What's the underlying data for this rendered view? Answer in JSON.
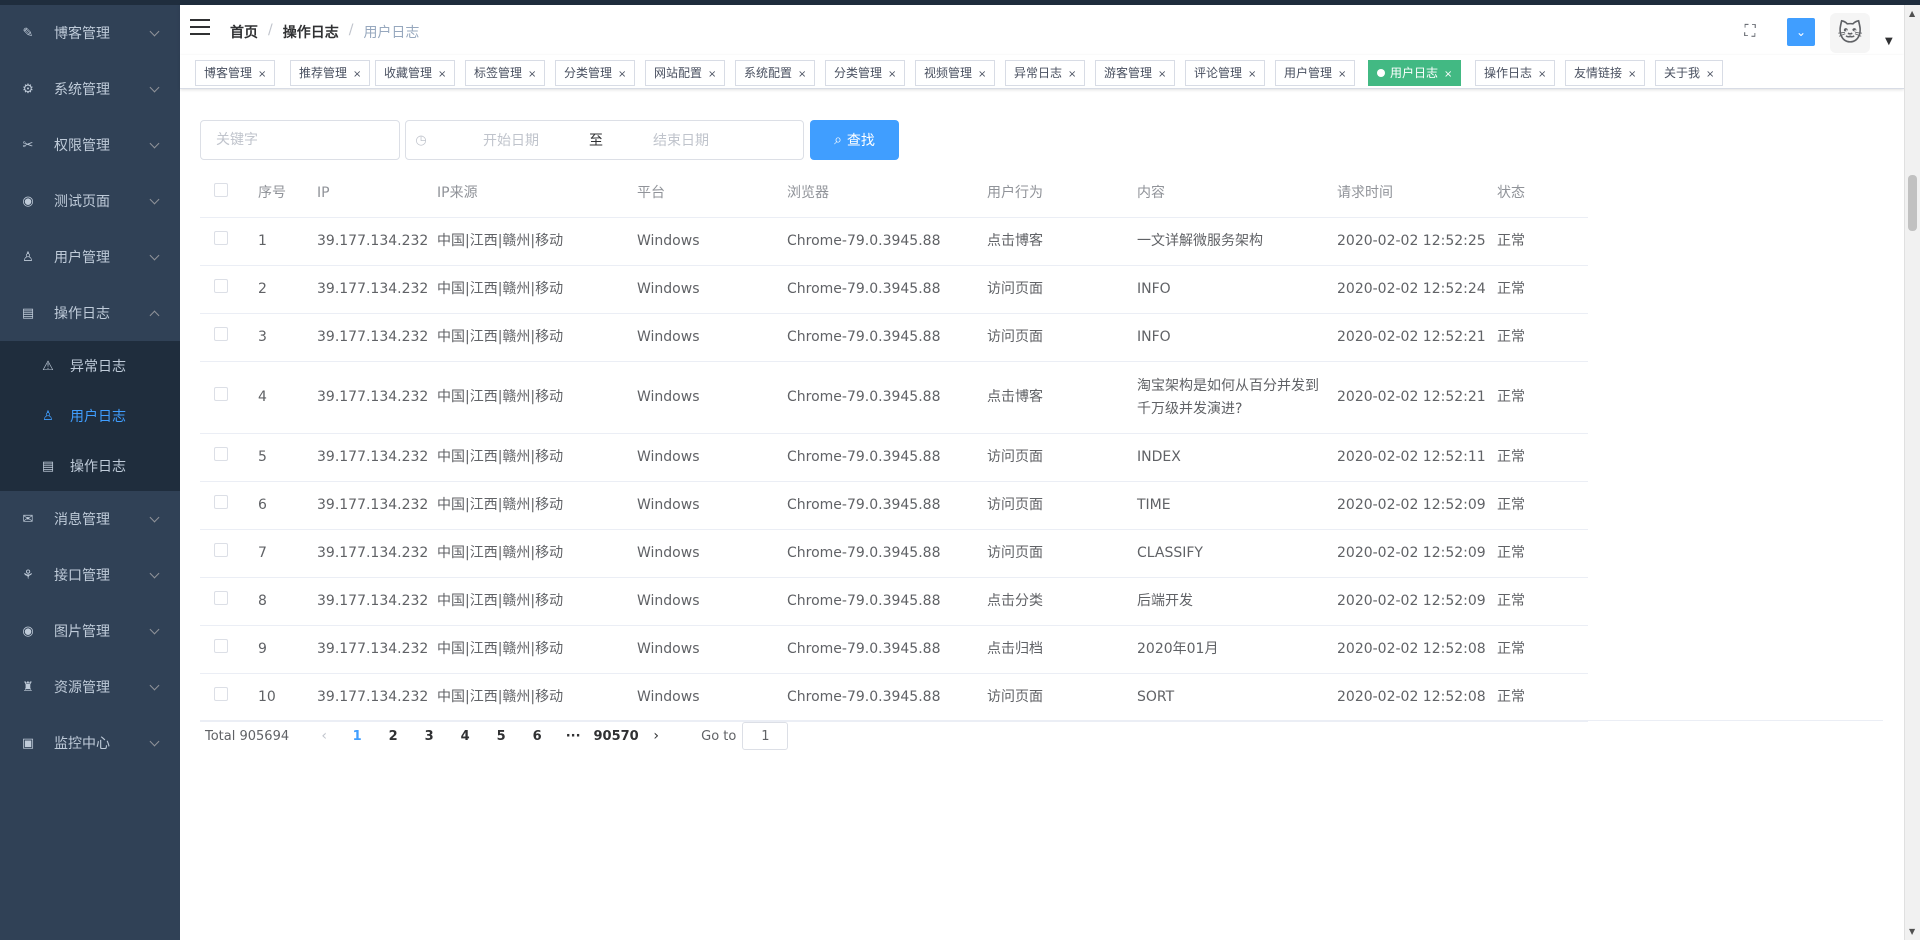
{
  "sidebar": {
    "items": [
      {
        "label": "博客管理",
        "icon": "edit-icon",
        "glyph": "✎"
      },
      {
        "label": "系统管理",
        "icon": "gear-icon",
        "glyph": "⚙"
      },
      {
        "label": "权限管理",
        "icon": "tools-icon",
        "glyph": "✂"
      },
      {
        "label": "测试页面",
        "icon": "chrome-icon",
        "glyph": "◉"
      },
      {
        "label": "用户管理",
        "icon": "user-icon",
        "glyph": "♙"
      },
      {
        "label": "操作日志",
        "icon": "log-icon",
        "glyph": "▤"
      },
      {
        "label": "消息管理",
        "icon": "message-icon",
        "glyph": "✉"
      },
      {
        "label": "接口管理",
        "icon": "api-icon",
        "glyph": "⚘"
      },
      {
        "label": "图片管理",
        "icon": "picture-icon",
        "glyph": "◉"
      },
      {
        "label": "资源管理",
        "icon": "school-icon",
        "glyph": "♜"
      },
      {
        "label": "监控中心",
        "icon": "monitor-icon",
        "glyph": "▣"
      }
    ],
    "subitems": [
      {
        "label": "异常日志",
        "icon": "warning-icon",
        "glyph": "⚠"
      },
      {
        "label": "用户日志",
        "icon": "user-icon",
        "glyph": "♙"
      },
      {
        "label": "操作日志",
        "icon": "log-icon",
        "glyph": "▤"
      }
    ]
  },
  "navbar": {
    "breadcrumb": [
      "首页",
      "操作日志",
      "用户日志"
    ]
  },
  "tags": [
    {
      "label": "博客管理"
    },
    {
      "label": "推荐管理"
    },
    {
      "label": "收藏管理"
    },
    {
      "label": "标签管理"
    },
    {
      "label": "分类管理"
    },
    {
      "label": "网站配置"
    },
    {
      "label": "系统配置"
    },
    {
      "label": "分类管理"
    },
    {
      "label": "视频管理"
    },
    {
      "label": "异常日志"
    },
    {
      "label": "游客管理"
    },
    {
      "label": "评论管理"
    },
    {
      "label": "用户管理"
    },
    {
      "label": "用户日志",
      "active": true
    },
    {
      "label": "操作日志"
    },
    {
      "label": "友情链接"
    },
    {
      "label": "关于我"
    }
  ],
  "filter": {
    "keyword_placeholder": "关键字",
    "start_placeholder": "开始日期",
    "range_sep": "至",
    "end_placeholder": "结束日期",
    "search_label": "查找"
  },
  "table": {
    "headers": [
      "序号",
      "IP",
      "IP来源",
      "平台",
      "浏览器",
      "用户行为",
      "内容",
      "请求时间",
      "状态"
    ],
    "rows": [
      [
        "1",
        "39.177.134.232",
        "中国|江西|赣州|移动",
        "Windows",
        "Chrome-79.0.3945.88",
        "点击博客",
        "一文详解微服务架构",
        "2020-02-02 12:52:25",
        "正常"
      ],
      [
        "2",
        "39.177.134.232",
        "中国|江西|赣州|移动",
        "Windows",
        "Chrome-79.0.3945.88",
        "访问页面",
        "INFO",
        "2020-02-02 12:52:24",
        "正常"
      ],
      [
        "3",
        "39.177.134.232",
        "中国|江西|赣州|移动",
        "Windows",
        "Chrome-79.0.3945.88",
        "访问页面",
        "INFO",
        "2020-02-02 12:52:21",
        "正常"
      ],
      [
        "4",
        "39.177.134.232",
        "中国|江西|赣州|移动",
        "Windows",
        "Chrome-79.0.3945.88",
        "点击博客",
        "淘宝架构是如何从百分并发到千万级并发演进?",
        "2020-02-02 12:52:21",
        "正常"
      ],
      [
        "5",
        "39.177.134.232",
        "中国|江西|赣州|移动",
        "Windows",
        "Chrome-79.0.3945.88",
        "访问页面",
        "INDEX",
        "2020-02-02 12:52:11",
        "正常"
      ],
      [
        "6",
        "39.177.134.232",
        "中国|江西|赣州|移动",
        "Windows",
        "Chrome-79.0.3945.88",
        "访问页面",
        "TIME",
        "2020-02-02 12:52:09",
        "正常"
      ],
      [
        "7",
        "39.177.134.232",
        "中国|江西|赣州|移动",
        "Windows",
        "Chrome-79.0.3945.88",
        "访问页面",
        "CLASSIFY",
        "2020-02-02 12:52:09",
        "正常"
      ],
      [
        "8",
        "39.177.134.232",
        "中国|江西|赣州|移动",
        "Windows",
        "Chrome-79.0.3945.88",
        "点击分类",
        "后端开发",
        "2020-02-02 12:52:09",
        "正常"
      ],
      [
        "9",
        "39.177.134.232",
        "中国|江西|赣州|移动",
        "Windows",
        "Chrome-79.0.3945.88",
        "点击归档",
        "2020年01月",
        "2020-02-02 12:52:08",
        "正常"
      ],
      [
        "10",
        "39.177.134.232",
        "中国|江西|赣州|移动",
        "Windows",
        "Chrome-79.0.3945.88",
        "访问页面",
        "SORT",
        "2020-02-02 12:52:08",
        "正常"
      ]
    ]
  },
  "pagination": {
    "total": "Total 905694",
    "pages": [
      "1",
      "2",
      "3",
      "4",
      "5",
      "6"
    ],
    "ellipsis": "···",
    "last": "90570",
    "goto_label": "Go to",
    "goto_value": "1",
    "current": 1
  },
  "colors": {
    "sidebar_bg": "#304156",
    "accent": "#409eff",
    "active_tag": "#42b983"
  }
}
